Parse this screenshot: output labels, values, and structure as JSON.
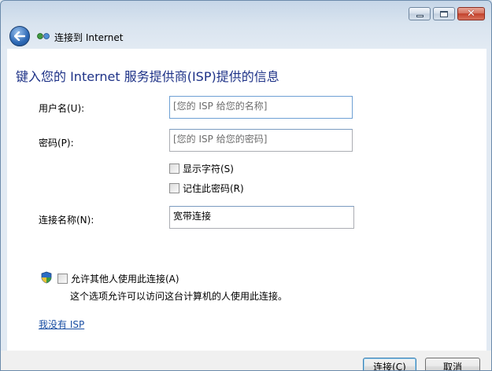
{
  "window": {
    "title": "连接到 Internet"
  },
  "heading": "键入您的 Internet 服务提供商(ISP)提供的信息",
  "form": {
    "username": {
      "label": "用户名(U):",
      "placeholder": "[您的 ISP 给您的名称]"
    },
    "password": {
      "label": "密码(P):",
      "placeholder": "[您的 ISP 给您的密码]"
    },
    "show_chars": {
      "label": "显示字符(S)",
      "checked": false
    },
    "remember_password": {
      "label": "记住此密码(R)",
      "checked": false
    },
    "connection_name": {
      "label": "连接名称(N):",
      "value": "宽带连接"
    }
  },
  "sharing": {
    "allow_others": {
      "label": "允许其他人使用此连接(A)",
      "checked": false
    },
    "description": "这个选项允许可以访问这台计算机的人使用此连接。"
  },
  "no_isp_link": "我没有 ISP",
  "buttons": {
    "connect": "连接(C)",
    "cancel": "取消"
  },
  "icons": {
    "back": "back-arrow-icon",
    "network": "network-connection-icon",
    "shield": "uac-shield-icon"
  }
}
